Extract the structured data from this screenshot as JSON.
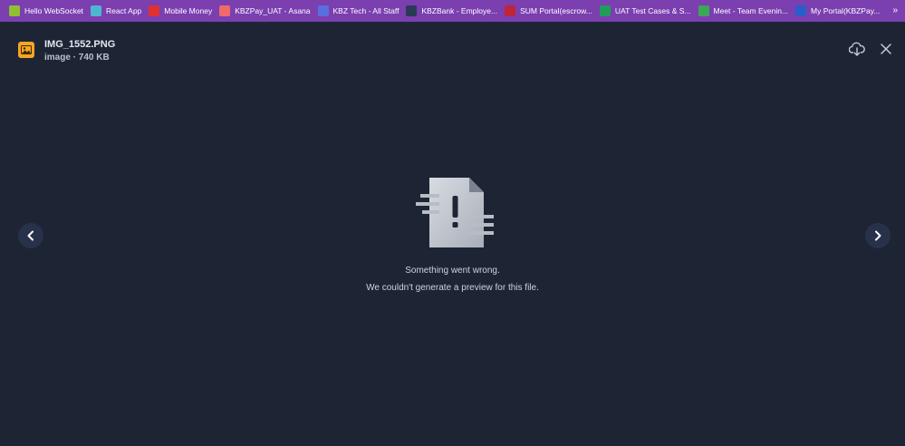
{
  "bookmarks": {
    "items": [
      {
        "label": "Hello WebSocket",
        "icon": "leaf-icon",
        "color": "#8fc031"
      },
      {
        "label": "React App",
        "icon": "react-icon",
        "color": "#4db6d0"
      },
      {
        "label": "Mobile Money",
        "icon": "mobile-money-icon",
        "color": "#e03131"
      },
      {
        "label": "KBZPay_UAT - Asana",
        "icon": "asana-icon",
        "color": "#f06a6a"
      },
      {
        "label": "KBZ Tech - All Staff",
        "icon": "teams-icon",
        "color": "#5b6ee0"
      },
      {
        "label": "KBZBank - Employe...",
        "icon": "kbz-icon",
        "color": "#2b3a55"
      },
      {
        "label": "SUM Portal(escrow...",
        "icon": "huawei-icon",
        "color": "#c0243a"
      },
      {
        "label": "UAT Test Cases & S...",
        "icon": "sheets-icon",
        "color": "#1e9e5a"
      },
      {
        "label": "Meet - Team Evenin...",
        "icon": "meet-icon",
        "color": "#3aa757"
      },
      {
        "label": "My Portal(KBZPay...",
        "icon": "portal-icon",
        "color": "#2a5dc9"
      }
    ],
    "more_label": "»"
  },
  "viewer": {
    "file_name": "IMG_1552.PNG",
    "file_meta": "image · 740 KB",
    "file_icon": "image-file-icon",
    "download_icon": "cloud-download-icon",
    "close_icon": "close-icon",
    "prev_icon": "chevron-left-icon",
    "next_icon": "chevron-right-icon",
    "error_title": "Something went wrong.",
    "error_detail": "We couldn't generate a preview for this file.",
    "accent_color": "#f5a524"
  }
}
